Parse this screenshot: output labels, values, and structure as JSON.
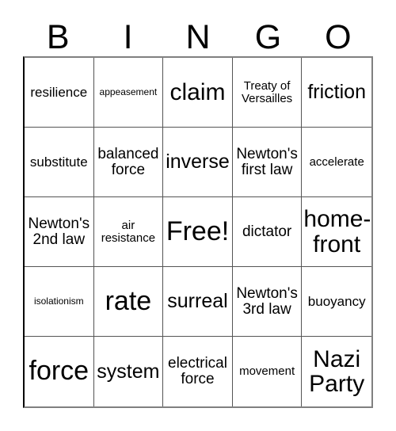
{
  "card": {
    "title": "BINGO",
    "header_letters": [
      "B",
      "I",
      "N",
      "G",
      "O"
    ],
    "grid_size": "5x5",
    "free_space_label": "Free!",
    "colors": {
      "background": "#ffffff",
      "text": "#000000",
      "grid_line": "#555555",
      "outer_border": "#808080"
    },
    "cells": [
      {
        "text": "resilience",
        "size": "md"
      },
      {
        "text": "appeasement",
        "size": "xs"
      },
      {
        "text": "claim",
        "size": "xxl"
      },
      {
        "text": "Treaty of\nVersailles",
        "size": "sm"
      },
      {
        "text": "friction",
        "size": "xl"
      },
      {
        "text": "substitute",
        "size": "md"
      },
      {
        "text": "balanced\nforce",
        "size": "lg"
      },
      {
        "text": "inverse",
        "size": "xl"
      },
      {
        "text": "Newton's\nfirst law",
        "size": "lg"
      },
      {
        "text": "accelerate",
        "size": "sm"
      },
      {
        "text": "Newton's\n2nd law",
        "size": "lg"
      },
      {
        "text": "air\nresistance",
        "size": "sm"
      },
      {
        "text": "Free!",
        "size": "huge"
      },
      {
        "text": "dictator",
        "size": "lg"
      },
      {
        "text": "home-\nfront",
        "size": "xxl"
      },
      {
        "text": "isolationism",
        "size": "xs"
      },
      {
        "text": "rate",
        "size": "huge"
      },
      {
        "text": "surreal",
        "size": "xl"
      },
      {
        "text": "Newton's\n3rd law",
        "size": "lg"
      },
      {
        "text": "buoyancy",
        "size": "md"
      },
      {
        "text": "force",
        "size": "huge"
      },
      {
        "text": "system",
        "size": "xl"
      },
      {
        "text": "electrical\nforce",
        "size": "lg"
      },
      {
        "text": "movement",
        "size": "sm"
      },
      {
        "text": "Nazi\nParty",
        "size": "xxl"
      }
    ]
  }
}
